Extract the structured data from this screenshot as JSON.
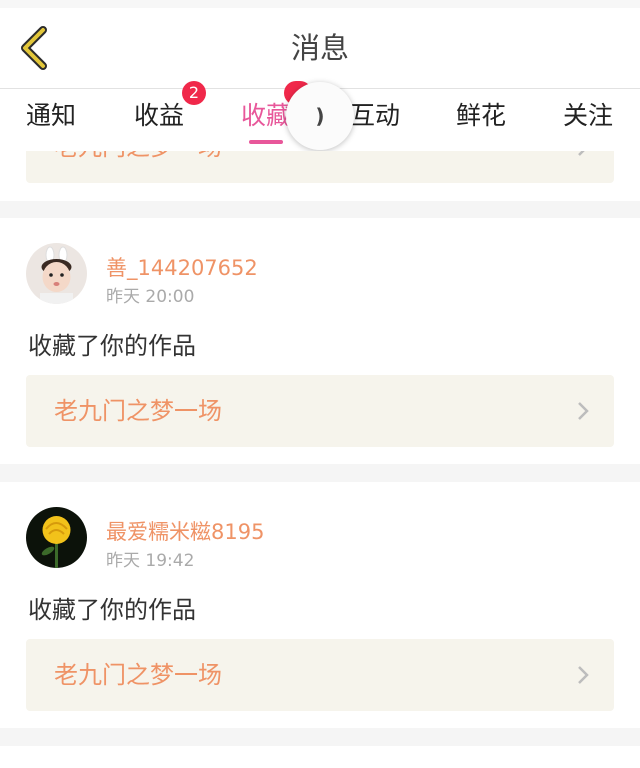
{
  "header": {
    "title": "消息",
    "back_icon": "chevron-left-icon"
  },
  "tabs": [
    {
      "label": "通知"
    },
    {
      "label": "收益",
      "badge": "2"
    },
    {
      "label": "收藏",
      "active": true
    },
    {
      "label": "互动"
    },
    {
      "label": "鲜花"
    },
    {
      "label": "关注"
    }
  ],
  "top_partial": {
    "work_title": "老九门之梦一场"
  },
  "messages": [
    {
      "username": "善_144207652",
      "time": "昨天 20:00",
      "action": "收藏了你的作品",
      "work_title": "老九门之梦一场",
      "avatar_icon": "child-avatar-icon"
    },
    {
      "username": "最爱糯米糍8195",
      "time": "昨天 19:42",
      "action": "收藏了你的作品",
      "work_title": "老九门之梦一场",
      "avatar_icon": "yellow-rose-avatar-icon"
    }
  ],
  "colors": {
    "accent": "#e8579a",
    "badge": "#f0284a",
    "username": "#ef9366",
    "work_box_bg": "#f6f4ec",
    "back_arrow": "#e2c63a"
  }
}
